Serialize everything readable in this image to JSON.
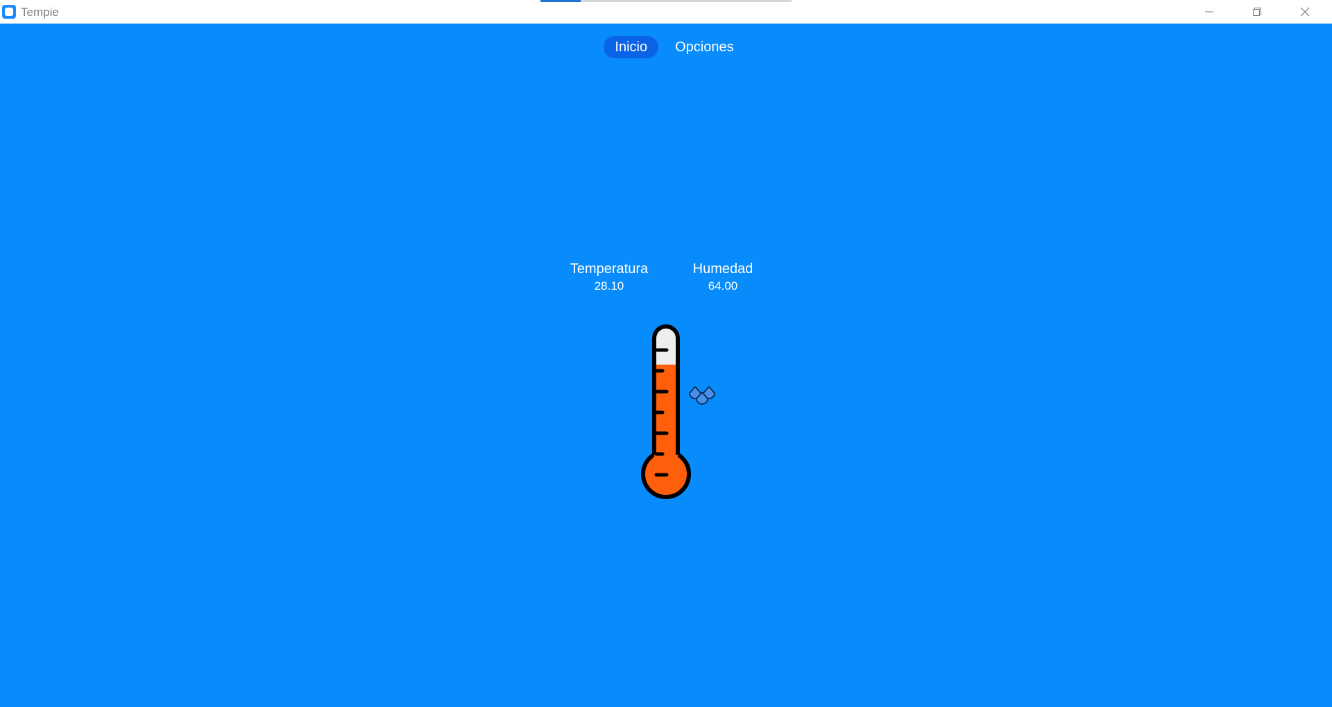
{
  "window": {
    "title": "Tempie",
    "loading_progress_fraction": 0.16
  },
  "nav": {
    "tabs": [
      {
        "label": "Inicio",
        "active": true
      },
      {
        "label": "Opciones",
        "active": false
      }
    ]
  },
  "readings": {
    "temperature": {
      "label": "Temperatura",
      "value": "28.10"
    },
    "humidity": {
      "label": "Humedad",
      "value": "64.00"
    }
  },
  "thermometer": {
    "fill_fraction": 0.72
  },
  "icons": {
    "thermometer": "thermometer-icon",
    "humidity": "water-drops-icon"
  },
  "colors": {
    "background": "#088bfb",
    "active_tab": "#0b63e8",
    "mercury": "#ff5e0a",
    "tube_empty": "#eeeeee",
    "drops": "#4a8fe8"
  }
}
